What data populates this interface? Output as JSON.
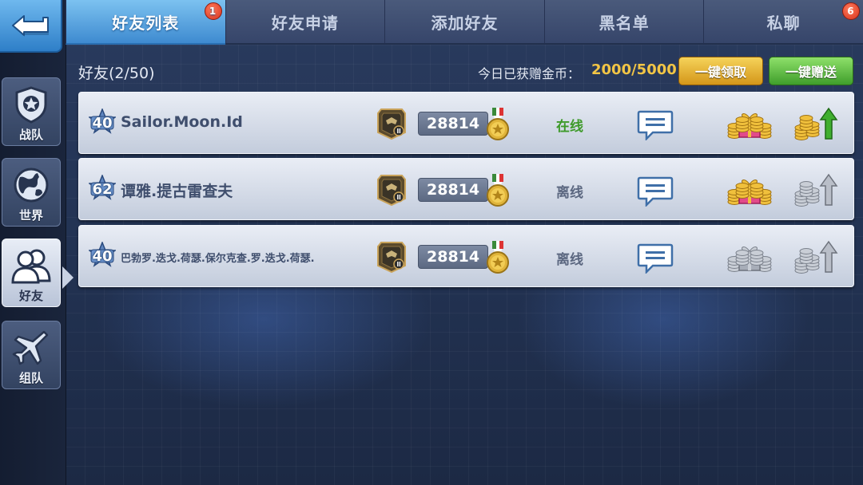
{
  "tabs": [
    {
      "label": "好友列表",
      "badge": "1"
    },
    {
      "label": "好友申请",
      "badge": ""
    },
    {
      "label": "添加好友",
      "badge": ""
    },
    {
      "label": "黑名单",
      "badge": ""
    },
    {
      "label": "私聊",
      "badge": "6"
    }
  ],
  "sidebar": {
    "items": [
      {
        "label": "战队",
        "icon": "shield-star-icon"
      },
      {
        "label": "世界",
        "icon": "globe-icon"
      },
      {
        "label": "好友",
        "icon": "friends-icon"
      },
      {
        "label": "组队",
        "icon": "jet-plane-icon"
      }
    ]
  },
  "info": {
    "friend_count": "好友(2/50)",
    "gold_label": "今日已获赠金币：",
    "gold_value": "2000/5000",
    "claim_all_label": "一键领取",
    "send_all_label": "一键赠送"
  },
  "friends": [
    {
      "level": "40",
      "name": "Sailor.Moon.Id",
      "score": "28814",
      "status": "在线",
      "online": true,
      "gift": "gold",
      "send": "gold"
    },
    {
      "level": "62",
      "name": "谭雅.提古雷查夫",
      "score": "28814",
      "status": "离线",
      "online": false,
      "gift": "gold",
      "send": "silver"
    },
    {
      "level": "40",
      "name": "巴勃罗.迭戈.荷瑟.保尔克查.罗.迭戈.荷瑟.",
      "score": "28814",
      "status": "离线",
      "online": false,
      "gift": "silver",
      "send": "silver"
    }
  ],
  "colors": {
    "active_tab": "#3e8ad0",
    "online": "#3e9a2a",
    "gold": "#f2c545",
    "badge": "#d8331e"
  }
}
